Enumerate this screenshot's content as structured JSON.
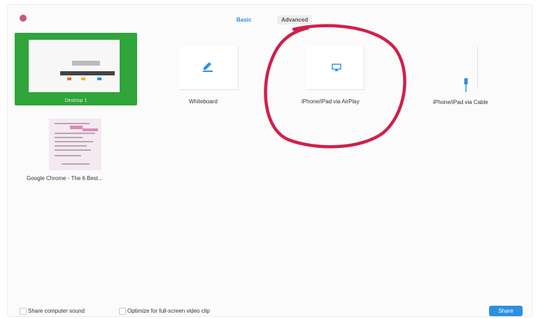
{
  "tabs": [
    {
      "label": "Basic",
      "active": true
    },
    {
      "label": "Advanced",
      "active": false
    }
  ],
  "sources": {
    "desktop": {
      "label": "Desktop 1"
    },
    "whiteboard": {
      "label": "Whiteboard",
      "icon": "pencil-icon"
    },
    "airplay": {
      "label": "iPhone/iPad via AirPlay",
      "icon": "airplay-icon"
    },
    "cable": {
      "label": "iPhone/iPad via Cable",
      "icon": "cable-icon"
    },
    "chrome": {
      "label": "Google Chrome - The 6 Best..."
    }
  },
  "footer": {
    "share_sound_label": "Share computer sound",
    "optimize_label": "Optimize for full-screen video clip",
    "share_button_label": "Share"
  },
  "colors": {
    "accent": "#2e8fe0",
    "selected_tile": "#2fa53a",
    "annotation": "#d0204a",
    "close_dot": "#c25a7c"
  }
}
